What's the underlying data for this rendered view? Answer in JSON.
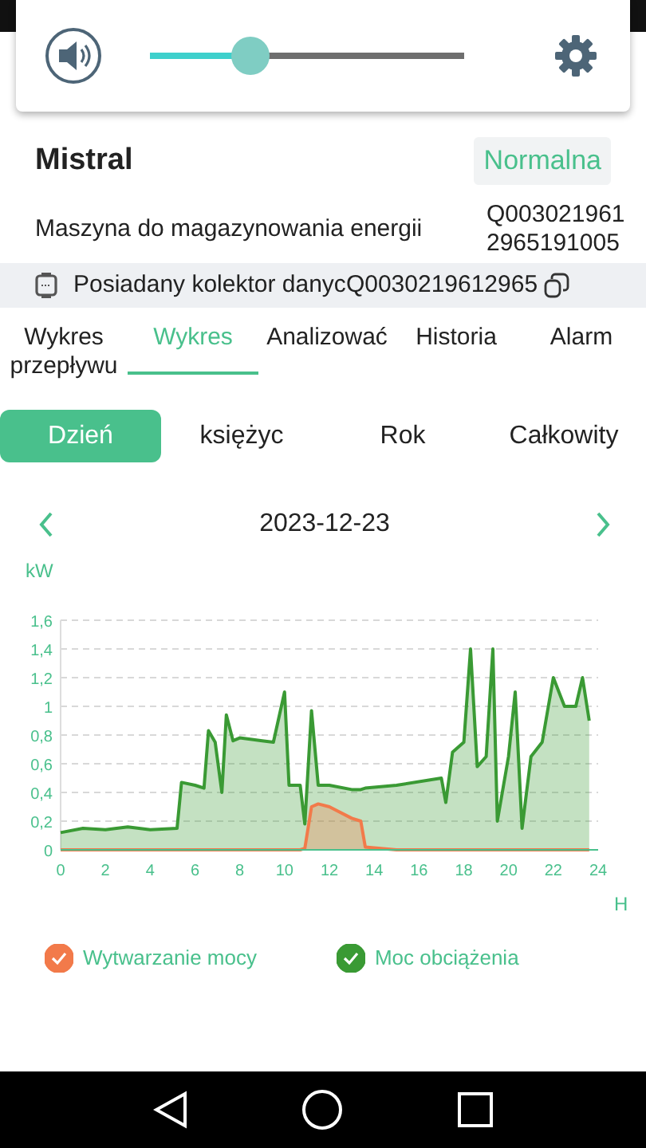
{
  "volume": {
    "level": 0.32
  },
  "device": {
    "name": "Mistral",
    "status": "Normalna",
    "type": "Maszyna do magazynowania energii",
    "serial": "Q0030219612965191005"
  },
  "collector": {
    "label": "Posiadany kolektor danyc",
    "serial": "Q0030219612965"
  },
  "tabs": [
    {
      "label": "Wykres przepływu",
      "selected": false
    },
    {
      "label": "Wykres",
      "selected": true
    },
    {
      "label": "Analizować",
      "selected": false
    },
    {
      "label": "Historia",
      "selected": false
    },
    {
      "label": "Alarm",
      "selected": false
    }
  ],
  "periods": [
    {
      "label": "Dzień",
      "selected": true
    },
    {
      "label": "księżyc",
      "selected": false
    },
    {
      "label": "Rok",
      "selected": false
    },
    {
      "label": "Całkowity",
      "selected": false
    }
  ],
  "date": "2023-12-23",
  "chart_data": {
    "type": "area",
    "grid": true,
    "xlabel": "H",
    "ylabel": "kW",
    "x": [
      0,
      1,
      2,
      3,
      4,
      5.2,
      5.4,
      6,
      6.4,
      6.6,
      6.9,
      7.2,
      7.4,
      7.7,
      8,
      9,
      9.5,
      10,
      10.2,
      10.7,
      10.9,
      11.2,
      11.5,
      12,
      13,
      13.4,
      13.6,
      15,
      17,
      17.2,
      17.5,
      18,
      18.3,
      18.6,
      19,
      19.3,
      19.5,
      20,
      20.3,
      20.6,
      21,
      21.5,
      22,
      22.5,
      23,
      23.3,
      23.6
    ],
    "series": [
      {
        "name": "Wytwarzanie mocy",
        "color": "#f27a4a",
        "values": [
          0,
          0,
          0,
          0,
          0,
          0,
          0,
          0,
          0,
          0,
          0,
          0,
          0,
          0,
          0,
          0,
          0,
          0,
          0,
          0,
          0.01,
          0.3,
          0.32,
          0.3,
          0.22,
          0.2,
          0.02,
          0,
          0,
          0,
          0,
          0,
          0,
          0,
          0,
          0,
          0,
          0,
          0,
          0,
          0,
          0,
          0,
          0,
          0,
          0,
          0
        ]
      },
      {
        "name": "Moc obciążenia",
        "color": "#3a9a34",
        "values": [
          0.12,
          0.15,
          0.14,
          0.16,
          0.14,
          0.15,
          0.47,
          0.45,
          0.43,
          0.83,
          0.75,
          0.4,
          0.94,
          0.76,
          0.78,
          0.76,
          0.75,
          1.1,
          0.45,
          0.45,
          0.18,
          0.97,
          0.45,
          0.45,
          0.42,
          0.42,
          0.43,
          0.45,
          0.5,
          0.33,
          0.68,
          0.75,
          1.4,
          0.58,
          0.65,
          1.4,
          0.2,
          0.65,
          1.1,
          0.15,
          0.65,
          0.75,
          1.2,
          1.0,
          1.0,
          1.2,
          0.9
        ]
      }
    ],
    "xlim": [
      0,
      24
    ],
    "ylim": [
      0,
      1.6
    ],
    "xticks": [
      0,
      2,
      4,
      6,
      8,
      10,
      12,
      14,
      16,
      18,
      20,
      22,
      24
    ],
    "yticks": [
      0,
      {
        "value": 0.2,
        "label": "0,2"
      },
      {
        "value": 0.4,
        "label": "0,4"
      },
      {
        "value": 0.6,
        "label": "0,6"
      },
      {
        "value": 0.8,
        "label": "0,8"
      },
      1,
      {
        "value": 1.2,
        "label": "1,2"
      },
      {
        "value": 1.4,
        "label": "1,4"
      },
      {
        "value": 1.6,
        "label": "1,6"
      }
    ]
  },
  "legend": [
    {
      "checked": true
    },
    {
      "checked": true
    }
  ]
}
